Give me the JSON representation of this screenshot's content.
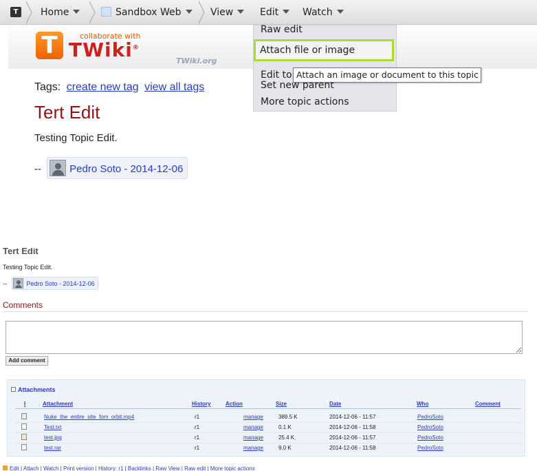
{
  "toolbar": {
    "logo": "T",
    "home": "Home",
    "web": "Sandbox Web",
    "view": "View",
    "edit": "Edit",
    "watch": "Watch"
  },
  "logo": {
    "collab": "collaborate with",
    "brand": "TWiki",
    "reg": "®",
    "org": "TWiki.org"
  },
  "edit_menu": {
    "items": [
      "Raw edit",
      "Attach file or image",
      "Edit topic preference settings",
      "Set new parent",
      "More topic actions"
    ],
    "tooltip": "Attach an image or document to this topic"
  },
  "topic": {
    "tags_label": "Tags:",
    "create_tag": "create new tag",
    "view_tags": "view all tags",
    "title": "Tert Edit",
    "body": "Testing Topic Edit.",
    "sig_prefix": "--",
    "signature": "Pedro Soto - 2014-12-06"
  },
  "comments": {
    "heading": "Comments",
    "button": "Add comment",
    "placeholder": ""
  },
  "attachments": {
    "heading": "Attachments",
    "columns": [
      "I",
      "Attachment",
      "History",
      "Action",
      "Size",
      "Date",
      "Who",
      "Comment"
    ],
    "rows": [
      {
        "name": "Nuke_the_entire_site_fom_orbit.mp4",
        "history": "r1",
        "action": "manage",
        "size": "389.5 K",
        "date": "2014-12-06 - 11:57",
        "who": "PedroSoto",
        "comment": ""
      },
      {
        "name": "Test.txt",
        "history": "r1",
        "action": "manage",
        "size": "0.1 K",
        "date": "2014-12-06 - 11:58",
        "who": "PedroSoto",
        "comment": ""
      },
      {
        "name": "test.jpg",
        "history": "r1",
        "action": "manage",
        "size": "25.4 K",
        "date": "2014-12-06 - 11:57",
        "who": "PedroSoto",
        "comment": ""
      },
      {
        "name": "test.rar",
        "history": "r1",
        "action": "manage",
        "size": "9.0 K",
        "date": "2014-12-06 - 11:58",
        "who": "PedroSoto",
        "comment": ""
      }
    ]
  },
  "bottom_actions": "Edit | Attach | Watch | Print version | History: r1 | Backlinks | Raw View | Raw edit | More topic actions",
  "colors": {
    "title": "#8c1515",
    "link": "#2a3bbd",
    "highlight": "#a9dc2c",
    "logo_orange": "#ef6000"
  }
}
